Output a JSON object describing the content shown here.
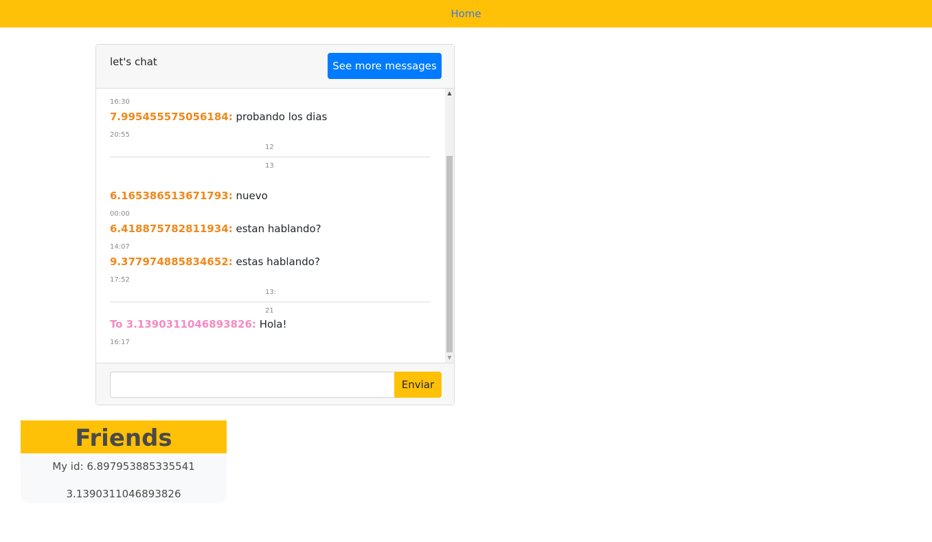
{
  "nav": {
    "home_label": "Home"
  },
  "chat": {
    "title": "let's chat",
    "more_button_label": "See more messages",
    "send_button_label": "Enviar",
    "input_placeholder": "",
    "entries": [
      {
        "time": "16:30"
      },
      {
        "sender": "7.995455575056184:",
        "text": "probando los dias",
        "time": "20:55"
      },
      {
        "separator_top": "12",
        "separator_bottom": "13"
      },
      {
        "sender": "6.165386513671793:",
        "text": "nuevo",
        "time": "00:00"
      },
      {
        "sender": "6.418875782811934:",
        "text": "estan hablando?",
        "time": "14:07"
      },
      {
        "sender": "9.377974885834652:",
        "text": "estas hablando?",
        "time": "17:52"
      },
      {
        "separator_top": "13:",
        "separator_bottom": "21"
      },
      {
        "sender": "To 3.1390311046893826:",
        "text": "Hola!",
        "time": "16:17"
      }
    ]
  },
  "friends": {
    "title": "Friends",
    "my_id": "My id: 6.897953885335541",
    "items": [
      "3.1390311046893826"
    ]
  },
  "colors": {
    "accent_yellow": "#ffc107",
    "primary_blue": "#007bff",
    "sender_orange": "#f0881a",
    "sender_pink": "#f58ac4"
  }
}
